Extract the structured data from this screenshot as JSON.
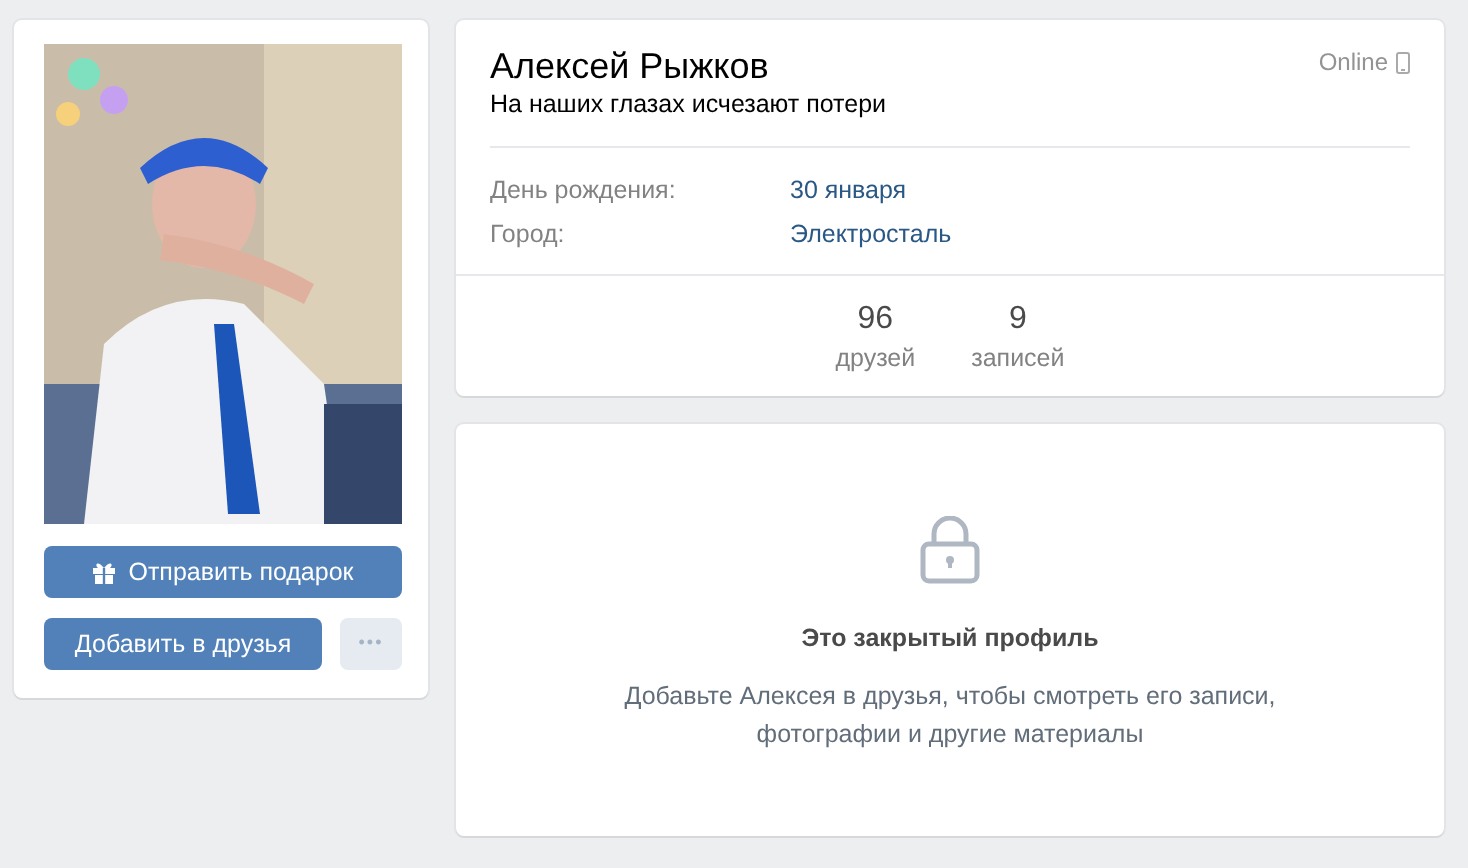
{
  "profile": {
    "name": "Алексей Рыжков",
    "status": "На наших глазах исчезают потери",
    "online": "Online",
    "online_mobile": true
  },
  "actions": [
    {
      "label": "Отправить подарок",
      "kind": "gift"
    },
    {
      "label": "Добавить в друзья",
      "kind": "primary"
    },
    {
      "label": "•••",
      "kind": "more"
    }
  ],
  "info": [
    {
      "label": "День рождения:",
      "value": "30 января"
    },
    {
      "label": "Город:",
      "value": "Электросталь"
    }
  ],
  "counters": [
    {
      "count": "96",
      "label": "друзей"
    },
    {
      "count": "9",
      "label": "записей"
    }
  ],
  "closed": {
    "title": "Это закрытый профиль",
    "text": "Добавьте Алексея в друзья, чтобы смотреть его записи, фотографии и другие материалы"
  }
}
